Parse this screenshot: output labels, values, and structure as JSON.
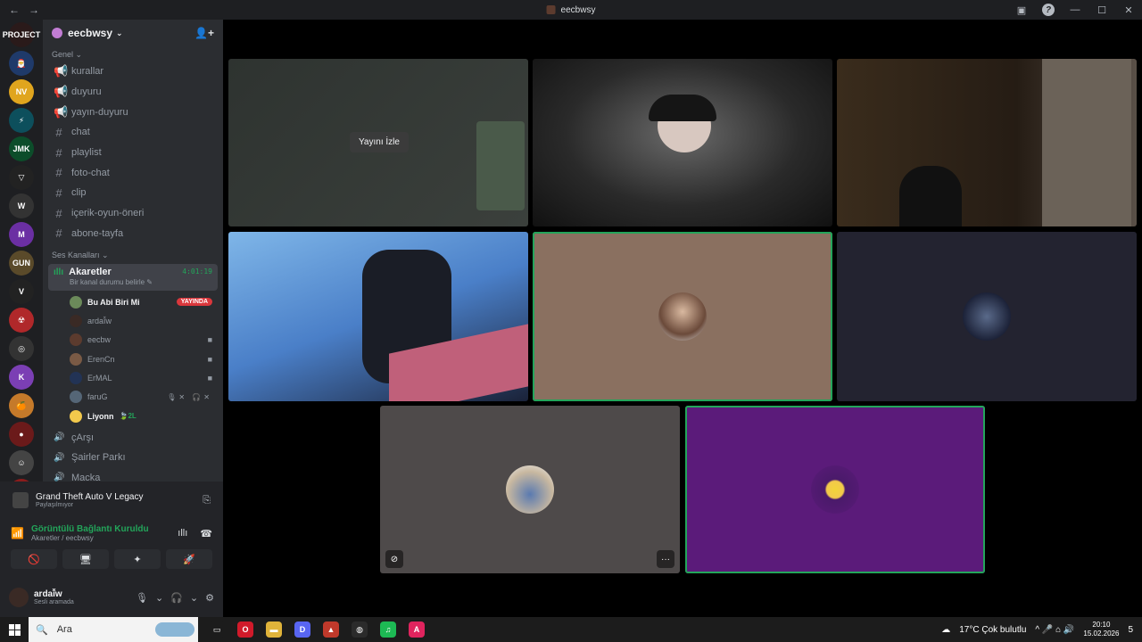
{
  "window": {
    "title": "eecbwsy",
    "back": "←",
    "forward": "→",
    "controls": {
      "help": "?",
      "minimize": "—",
      "maximize": "☐",
      "close": "✕"
    }
  },
  "servers": [
    {
      "label": "PROJECT",
      "color": "#2a1a1a"
    },
    {
      "label": "🎅",
      "color": "#1f3a6a"
    },
    {
      "label": "NV",
      "color": "#e0a51e"
    },
    {
      "label": "⚡",
      "color": "#0d4f5c"
    },
    {
      "label": "JMK",
      "color": "#0c4d2a"
    },
    {
      "label": "▽",
      "color": "#222"
    },
    {
      "label": "W",
      "color": "#333"
    },
    {
      "label": "M",
      "color": "#6b2fa3"
    },
    {
      "label": "GUN",
      "color": "#5a4a2a"
    },
    {
      "label": "V",
      "color": "#222"
    },
    {
      "label": "☢",
      "color": "#b0282a"
    },
    {
      "label": "◎",
      "color": "#333"
    },
    {
      "label": "K",
      "color": "#7b3fb4"
    },
    {
      "label": "🍊",
      "color": "#c57a2a"
    },
    {
      "label": "●",
      "color": "#6b1a1a"
    },
    {
      "label": "☺",
      "color": "#444"
    },
    {
      "label": "●",
      "color": "#8a1c1c"
    }
  ],
  "guild": {
    "name": "eecbwsy",
    "invite_icon": "👤+"
  },
  "categories": {
    "text": "Genel",
    "voice": "Ses Kanalları"
  },
  "text_channels": [
    "kurallar",
    "duyuru",
    "yayın-duyuru",
    "chat",
    "playlist",
    "foto-chat",
    "clip",
    "içerik-oyun-öneri",
    "abone-tayfa"
  ],
  "text_channel_icons": [
    "📢",
    "📢",
    "📢",
    "#",
    "#",
    "#",
    "#",
    "#",
    "#"
  ],
  "voice_active": {
    "name": "Akaretler",
    "timer": "4:01:19",
    "status": "Bir kanal durumu belirle"
  },
  "voice_users": [
    {
      "name": "Bu Abi Biri Mi",
      "bold": true,
      "tag": "YAYINDA",
      "color": "#6b8a5a"
    },
    {
      "name": "ardaî̆w",
      "color": "#3a2a25"
    },
    {
      "name": "eecbw",
      "color": "#5c3b2e",
      "icon": "■"
    },
    {
      "name": "ErenCn",
      "color": "#7a5a45",
      "icon": "■"
    },
    {
      "name": "ErMAL",
      "color": "#223355",
      "icon": "■"
    },
    {
      "name": "faruG",
      "color": "#556677",
      "icon": "🎙✕ 🎧✕"
    },
    {
      "name": "Liyonn",
      "bold": true,
      "badge": "🍃2L",
      "color": "#f2c94c"
    }
  ],
  "voice_channels": [
    "çArşı",
    "Şairler Parkı",
    "Macka"
  ],
  "activity": {
    "game": "Grand Theft Auto V Legacy",
    "sub": "Paylaşılmıyor",
    "share_icon": "⎘"
  },
  "rtc": {
    "title": "Görüntülü Bağlantı Kuruldu",
    "sub": "Akaretler / eecbwsy",
    "noise_icon": "ıllı",
    "disconnect_icon": "☎",
    "buttons": [
      "🚫",
      "🖥",
      "✦",
      "🚀"
    ]
  },
  "user": {
    "name": "ardaî̆w",
    "status": "Sesli aramada",
    "mic": "🎙",
    "headset": "🎧",
    "settings": "⚙",
    "caret": "⌄"
  },
  "stream": {
    "watch_label": "Yayını İzle"
  },
  "tiles": {
    "more_icon": "···",
    "mute_icon": "⊘"
  },
  "taskbar": {
    "search_placeholder": "Ara",
    "apps": [
      {
        "label": "▭",
        "color": "#1c1c1c"
      },
      {
        "label": "O",
        "color": "#d11a2a"
      },
      {
        "label": "▬",
        "color": "#e0b33a"
      },
      {
        "label": "D",
        "color": "#5865f2"
      },
      {
        "label": "▲",
        "color": "#c0392b"
      },
      {
        "label": "◍",
        "color": "#2b2b2b"
      },
      {
        "label": "♫",
        "color": "#1db954"
      },
      {
        "label": "A",
        "color": "#e0245e"
      }
    ],
    "weather": "17°C  Çok bulutlu",
    "tray_icons": "^  🎤  ⌂  🔊",
    "time": "20:10",
    "date": "15.02.2026",
    "notif": "5"
  }
}
